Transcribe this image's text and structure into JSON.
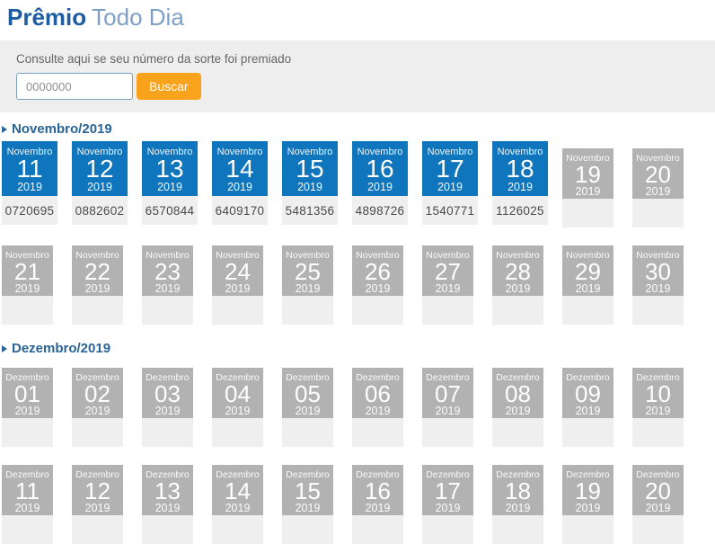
{
  "page_title": {
    "primary": "Prêmio",
    "secondary": "Todo Dia"
  },
  "search": {
    "label": "Consulte aqui se seu número da sorte foi premiado",
    "input_value": "0000000",
    "button_label": "Buscar"
  },
  "colors": {
    "title_primary": "#1e5da1",
    "title_secondary": "#7f9fc6",
    "active_tile": "#0f75bd",
    "inactive_tile": "#b2b2b2",
    "footer_strip": "#efefef",
    "panel_background": "#eeeeee",
    "button_orange": "#f9a21b",
    "section_heading": "#2a6496"
  },
  "sections": [
    {
      "heading": "Novembro/2019",
      "rows": [
        [
          {
            "month": "Novembro",
            "day": "11",
            "year": "2019",
            "active": true,
            "number": "0720695"
          },
          {
            "month": "Novembro",
            "day": "12",
            "year": "2019",
            "active": true,
            "number": "0882602"
          },
          {
            "month": "Novembro",
            "day": "13",
            "year": "2019",
            "active": true,
            "number": "6570844"
          },
          {
            "month": "Novembro",
            "day": "14",
            "year": "2019",
            "active": true,
            "number": "6409170"
          },
          {
            "month": "Novembro",
            "day": "15",
            "year": "2019",
            "active": true,
            "number": "5481356"
          },
          {
            "month": "Novembro",
            "day": "16",
            "year": "2019",
            "active": true,
            "number": "4898726"
          },
          {
            "month": "Novembro",
            "day": "17",
            "year": "2019",
            "active": true,
            "number": "1540771"
          },
          {
            "month": "Novembro",
            "day": "18",
            "year": "2019",
            "active": true,
            "number": "1126025"
          },
          {
            "month": "Novembro",
            "day": "19",
            "year": "2019",
            "active": false,
            "number": ""
          },
          {
            "month": "Novembro",
            "day": "20",
            "year": "2019",
            "active": false,
            "number": ""
          }
        ],
        [
          {
            "month": "Novembro",
            "day": "21",
            "year": "2019",
            "active": false,
            "number": ""
          },
          {
            "month": "Novembro",
            "day": "22",
            "year": "2019",
            "active": false,
            "number": ""
          },
          {
            "month": "Novembro",
            "day": "23",
            "year": "2019",
            "active": false,
            "number": ""
          },
          {
            "month": "Novembro",
            "day": "24",
            "year": "2019",
            "active": false,
            "number": ""
          },
          {
            "month": "Novembro",
            "day": "25",
            "year": "2019",
            "active": false,
            "number": ""
          },
          {
            "month": "Novembro",
            "day": "26",
            "year": "2019",
            "active": false,
            "number": ""
          },
          {
            "month": "Novembro",
            "day": "27",
            "year": "2019",
            "active": false,
            "number": ""
          },
          {
            "month": "Novembro",
            "day": "28",
            "year": "2019",
            "active": false,
            "number": ""
          },
          {
            "month": "Novembro",
            "day": "29",
            "year": "2019",
            "active": false,
            "number": ""
          },
          {
            "month": "Novembro",
            "day": "30",
            "year": "2019",
            "active": false,
            "number": ""
          }
        ]
      ]
    },
    {
      "heading": "Dezembro/2019",
      "rows": [
        [
          {
            "month": "Dezembro",
            "day": "01",
            "year": "2019",
            "active": false,
            "number": ""
          },
          {
            "month": "Dezembro",
            "day": "02",
            "year": "2019",
            "active": false,
            "number": ""
          },
          {
            "month": "Dezembro",
            "day": "03",
            "year": "2019",
            "active": false,
            "number": ""
          },
          {
            "month": "Dezembro",
            "day": "04",
            "year": "2019",
            "active": false,
            "number": ""
          },
          {
            "month": "Dezembro",
            "day": "05",
            "year": "2019",
            "active": false,
            "number": ""
          },
          {
            "month": "Dezembro",
            "day": "06",
            "year": "2019",
            "active": false,
            "number": ""
          },
          {
            "month": "Dezembro",
            "day": "07",
            "year": "2019",
            "active": false,
            "number": ""
          },
          {
            "month": "Dezembro",
            "day": "08",
            "year": "2019",
            "active": false,
            "number": ""
          },
          {
            "month": "Dezembro",
            "day": "09",
            "year": "2019",
            "active": false,
            "number": ""
          },
          {
            "month": "Dezembro",
            "day": "10",
            "year": "2019",
            "active": false,
            "number": ""
          }
        ],
        [
          {
            "month": "Dezembro",
            "day": "11",
            "year": "2019",
            "active": false,
            "number": ""
          },
          {
            "month": "Dezembro",
            "day": "12",
            "year": "2019",
            "active": false,
            "number": ""
          },
          {
            "month": "Dezembro",
            "day": "13",
            "year": "2019",
            "active": false,
            "number": ""
          },
          {
            "month": "Dezembro",
            "day": "14",
            "year": "2019",
            "active": false,
            "number": ""
          },
          {
            "month": "Dezembro",
            "day": "15",
            "year": "2019",
            "active": false,
            "number": ""
          },
          {
            "month": "Dezembro",
            "day": "16",
            "year": "2019",
            "active": false,
            "number": ""
          },
          {
            "month": "Dezembro",
            "day": "17",
            "year": "2019",
            "active": false,
            "number": ""
          },
          {
            "month": "Dezembro",
            "day": "18",
            "year": "2019",
            "active": false,
            "number": ""
          },
          {
            "month": "Dezembro",
            "day": "19",
            "year": "2019",
            "active": false,
            "number": ""
          },
          {
            "month": "Dezembro",
            "day": "20",
            "year": "2019",
            "active": false,
            "number": ""
          }
        ]
      ]
    }
  ]
}
